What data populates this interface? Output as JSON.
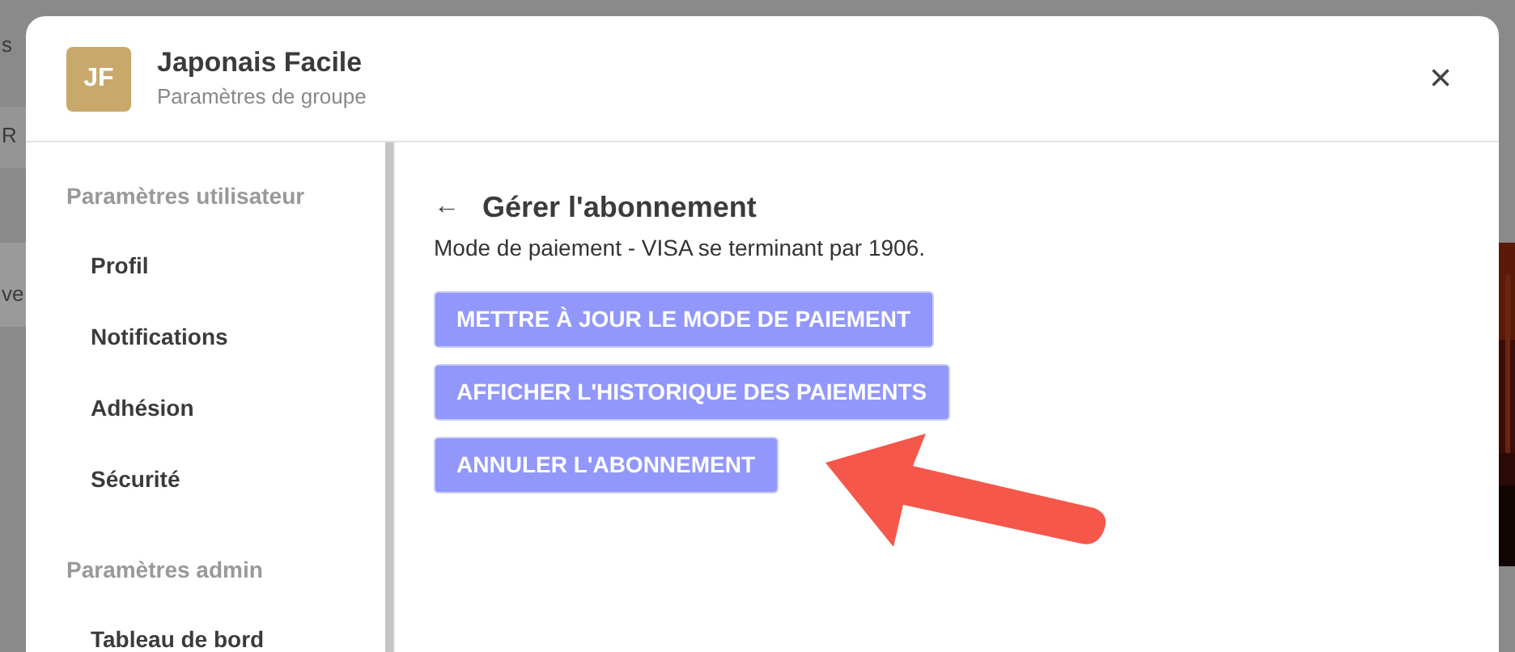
{
  "background": {
    "fragments": [
      "s",
      "R",
      "ve"
    ]
  },
  "dialog": {
    "avatar": "JF",
    "title": "Japonais Facile",
    "subtitle": "Paramètres de groupe",
    "close": "×"
  },
  "sidebar": {
    "sections": [
      {
        "heading": "Paramètres utilisateur",
        "items": [
          "Profil",
          "Notifications",
          "Adhésion",
          "Sécurité"
        ]
      },
      {
        "heading": "Paramètres admin",
        "items": [
          "Tableau de bord"
        ]
      }
    ]
  },
  "content": {
    "back": "←",
    "title": "Gérer l'abonnement",
    "description": "Mode de paiement - VISA se terminant par 1906.",
    "buttons": [
      "METTRE À JOUR LE MODE DE PAIEMENT",
      "AFFICHER L'HISTORIQUE DES PAIEMENTS",
      "ANNULER L'ABONNEMENT"
    ]
  }
}
